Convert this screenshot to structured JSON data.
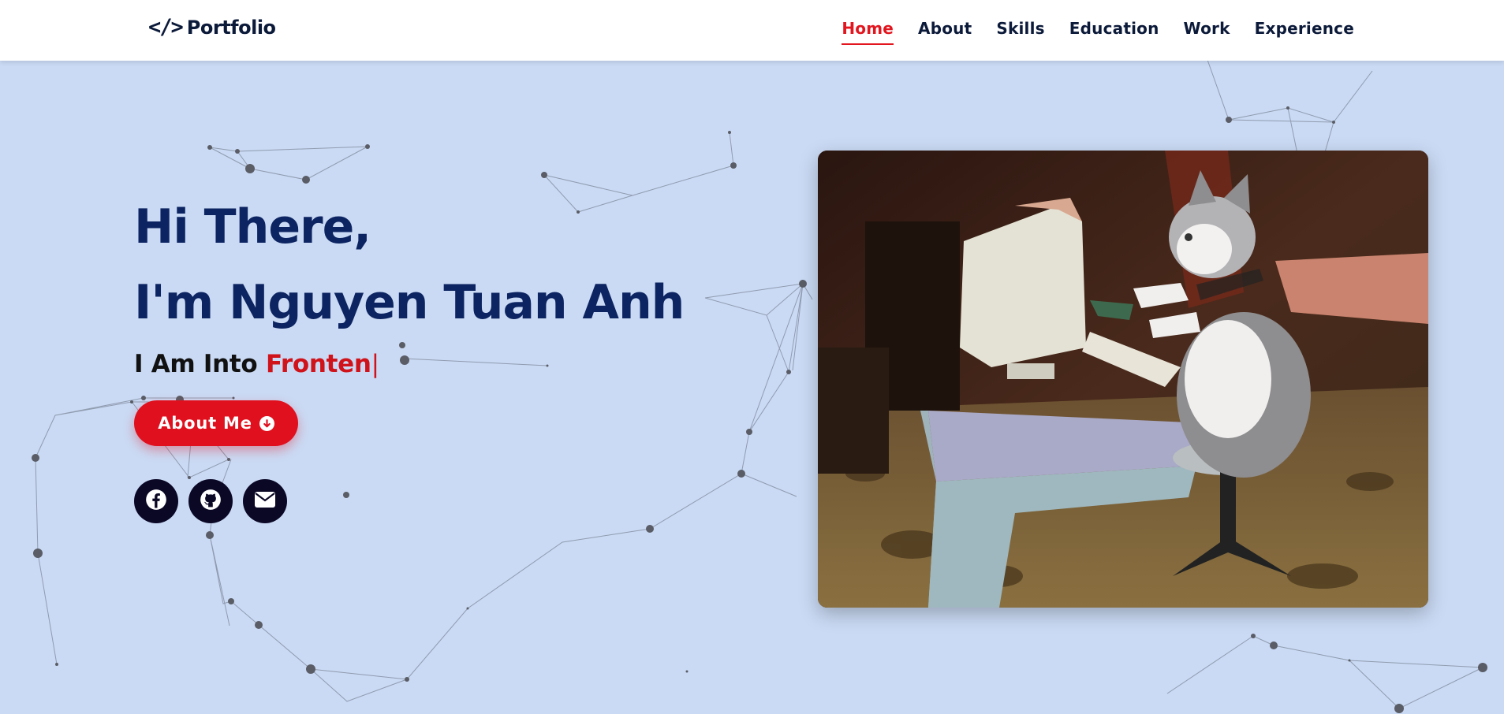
{
  "header": {
    "logo_icon": "</>",
    "logo_text": "Portfolio",
    "nav": [
      {
        "label": "Home",
        "active": true
      },
      {
        "label": "About"
      },
      {
        "label": "Skills"
      },
      {
        "label": "Education"
      },
      {
        "label": "Work"
      },
      {
        "label": "Experience"
      }
    ]
  },
  "hero": {
    "greeting": "Hi There,",
    "name_line": "I'm Nguyen Tuan Anh",
    "sub_prefix": "I Am Into",
    "sub_typed": "Fronten",
    "sub_cursor": "|",
    "about_button": "About Me",
    "about_button_icon": "arrow-down-circle-icon",
    "socials": [
      {
        "icon": "facebook-icon"
      },
      {
        "icon": "github-icon"
      },
      {
        "icon": "envelope-icon"
      }
    ]
  },
  "photo": {
    "alt_icon": "kitten-at-computer-image"
  },
  "colors": {
    "background": "#cadaf4",
    "accent": "#e2161f",
    "heading": "#0c2461",
    "social_bg": "#0b0826"
  }
}
